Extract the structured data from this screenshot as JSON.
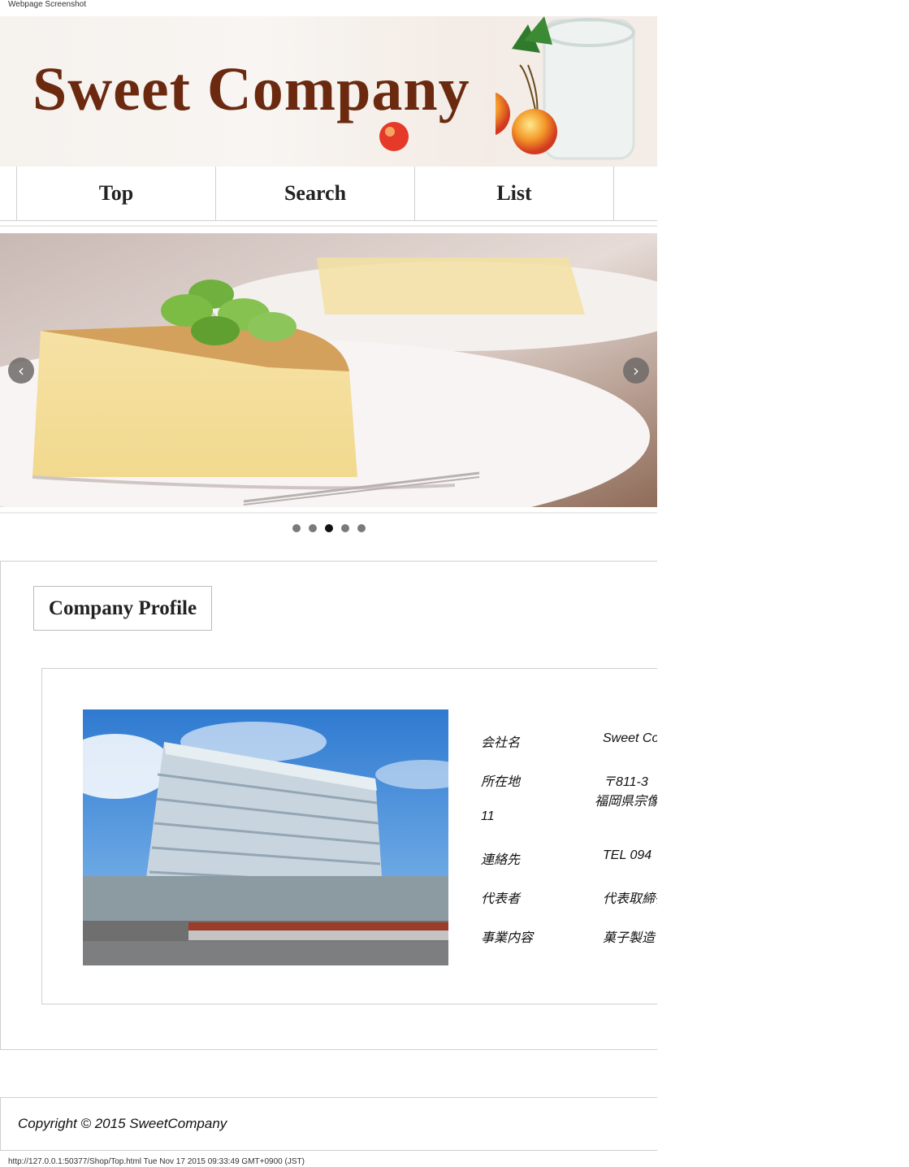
{
  "print": {
    "title": "Webpage Screenshot",
    "footer": "http://127.0.0.1:50377/Shop/Top.html Tue Nov 17 2015 09:33:49 GMT+0900 (JST)"
  },
  "header": {
    "site_title": "Sweet Company"
  },
  "nav": {
    "items": [
      {
        "label": "Top"
      },
      {
        "label": "Search"
      },
      {
        "label": "List"
      }
    ]
  },
  "slider": {
    "prev_icon": "chevron-left-icon",
    "next_icon": "chevron-right-icon",
    "prev_glyph": "‹",
    "next_glyph": "›",
    "slide_count": 5,
    "active_index": 2
  },
  "profile": {
    "heading": "Company Profile",
    "rows": [
      {
        "key": "会社名",
        "value": "Sweet Co"
      },
      {
        "key": "所在地",
        "value": "〒811-3",
        "value2": "福岡県宗像",
        "extra": "11"
      },
      {
        "key": "連絡先",
        "value": "TEL 094"
      },
      {
        "key": "代表者",
        "value": "代表取締役"
      },
      {
        "key": "事業内容",
        "value": "菓子製造"
      }
    ]
  },
  "footer": {
    "copyright": "Copyright © 2015 SweetCompany"
  }
}
